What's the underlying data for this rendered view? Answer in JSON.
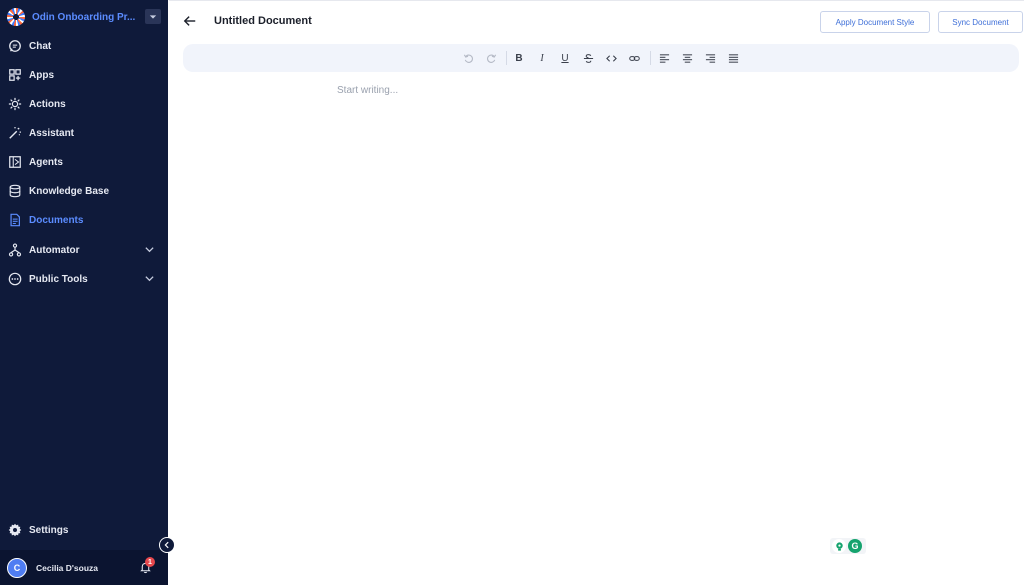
{
  "workspace": {
    "name": "Odin Onboarding Pr..."
  },
  "nav": [
    {
      "label": "Chat",
      "icon": "chat-icon"
    },
    {
      "label": "Apps",
      "icon": "apps-icon"
    },
    {
      "label": "Actions",
      "icon": "actions-icon"
    },
    {
      "label": "Assistant",
      "icon": "wand-icon"
    },
    {
      "label": "Agents",
      "icon": "agents-icon"
    },
    {
      "label": "Knowledge Base",
      "icon": "database-icon"
    },
    {
      "label": "Documents",
      "icon": "document-icon",
      "active": true
    },
    {
      "label": "Automator",
      "icon": "automator-icon",
      "expandable": true
    },
    {
      "label": "Public Tools",
      "icon": "public-tools-icon",
      "expandable": true
    }
  ],
  "settings": {
    "label": "Settings"
  },
  "user": {
    "initial": "C",
    "name": "Cecilia D'souza",
    "notifications": "1"
  },
  "document": {
    "title": "Untitled Document",
    "placeholder": "Start writing..."
  },
  "buttons": {
    "apply_style": "Apply Document Style",
    "sync": "Sync Document"
  },
  "toolbar": {
    "bold": "B",
    "italic": "I",
    "underline": "U"
  },
  "colors": {
    "sidebar_bg": "#0f1a3a",
    "accent": "#5b8cff",
    "button_text": "#3e6fd8",
    "toolbar_bg": "#f1f4fb"
  }
}
